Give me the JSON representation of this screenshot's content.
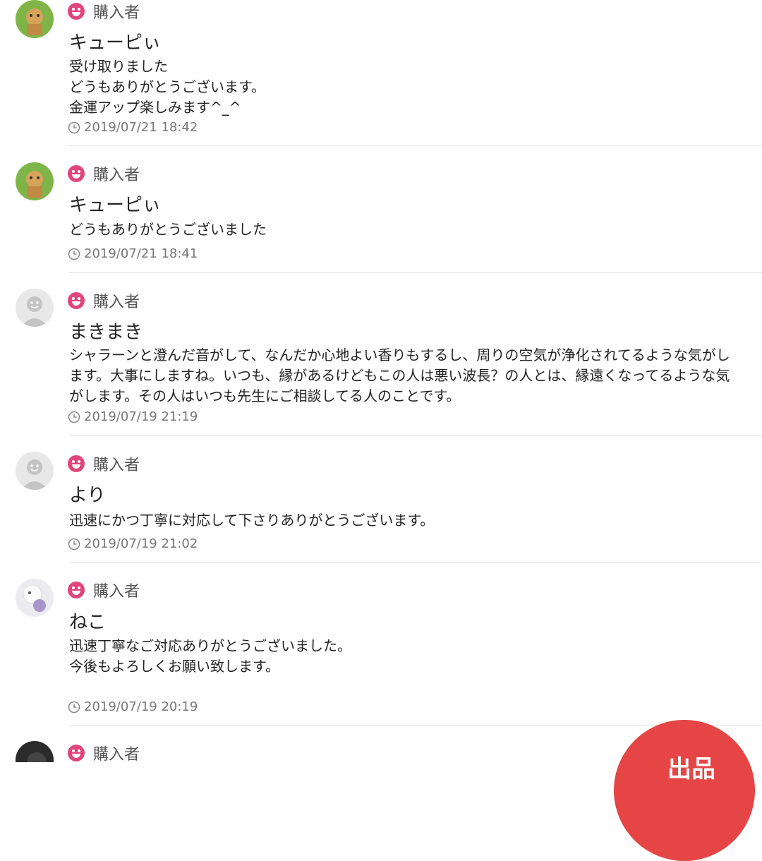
{
  "comments": [
    {
      "role": "購入者",
      "name": "キューピぃ",
      "body": "受け取りました\nどうもありがとうございます。\n金運アップ楽しみます^_^",
      "time": "2019/07/21 18:42",
      "avatar": "photo-avatar-icon"
    },
    {
      "role": "購入者",
      "name": "キューピぃ",
      "body": "どうもありがとうございました",
      "time": "2019/07/21 18:41",
      "avatar": "photo-avatar-icon"
    },
    {
      "role": "購入者",
      "name": "まきまき",
      "body": "シャラーンと澄んだ音がして、なんだか心地よい香りもするし、周りの空気が浄化されてるような気がします。大事にしますね。いつも、縁があるけどもこの人は悪い波長？の人とは、縁遠くなってるような気がします。その人はいつも先生にご相談してる人のことです。",
      "time": "2019/07/19 21:19",
      "avatar": "default-avatar-icon"
    },
    {
      "role": "購入者",
      "name": "より",
      "body": "迅速にかつ丁寧に対応して下さりありがとうございます。",
      "time": "2019/07/19 21:02",
      "avatar": "default-avatar-icon"
    },
    {
      "role": "購入者",
      "name": "ねこ",
      "body": "迅速丁寧なご対応ありがとうございました。\n今後もよろしくお願い致します。",
      "time": "2019/07/19 20:19",
      "avatar": "photo-avatar-icon"
    },
    {
      "role": "購入者",
      "avatar": "photo-avatar-icon"
    }
  ],
  "fab": {
    "label": "出品",
    "color": "#e54545"
  },
  "colors": {
    "badge": "#e0457b",
    "divider": "#e3e3e3",
    "time": "#777777"
  }
}
